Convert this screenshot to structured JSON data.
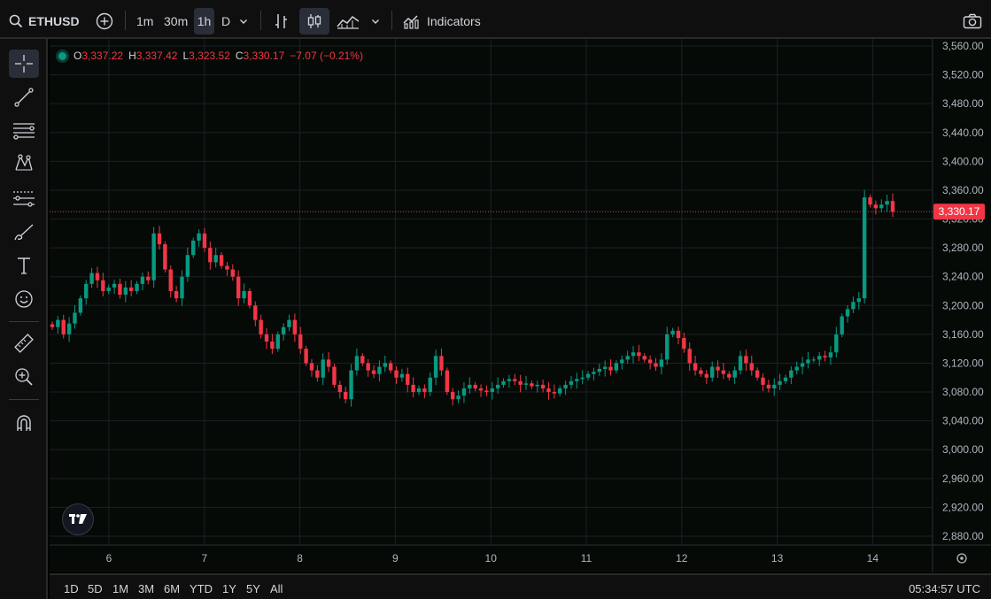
{
  "topbar": {
    "symbol": "ETHUSD",
    "intervals": [
      "1m",
      "30m",
      "1h",
      "D"
    ],
    "active_interval": "1h",
    "indicators_label": "Indicators"
  },
  "legend": {
    "o_label": "O",
    "o": "3,337.22",
    "h_label": "H",
    "h": "3,337.42",
    "l_label": "L",
    "l": "3,323.52",
    "c_label": "C",
    "c": "3,330.17",
    "change": "−7.07 (−0.21%)"
  },
  "bottombar": {
    "ranges": [
      "1D",
      "5D",
      "1M",
      "3M",
      "6M",
      "YTD",
      "1Y",
      "5Y",
      "All"
    ],
    "clock": "05:34:57 UTC"
  },
  "colors": {
    "up": "#089981",
    "down": "#f23645",
    "background": "#000000",
    "grid": "#1c1f26"
  },
  "chart_data": {
    "type": "candlestick",
    "interval": "1h",
    "price_labels": [
      "3,560.00",
      "3,520.00",
      "3,480.00",
      "3,440.00",
      "3,400.00",
      "3,360.00",
      "3,320.00",
      "3,280.00",
      "3,240.00",
      "3,200.00",
      "3,160.00",
      "3,120.00",
      "3,080.00",
      "3,040.00",
      "3,000.00",
      "2,960.00",
      "2,920.00",
      "2,880.00"
    ],
    "ylim": [
      2860,
      3575
    ],
    "date_labels": [
      "6",
      "7",
      "8",
      "9",
      "10",
      "11",
      "12",
      "13",
      "14"
    ],
    "current_price": 3330.17,
    "current_price_label": "3,330.17",
    "close_series": [
      3170,
      3180,
      3160,
      3175,
      3190,
      3210,
      3230,
      3245,
      3235,
      3220,
      3225,
      3230,
      3215,
      3225,
      3220,
      3230,
      3240,
      3235,
      3300,
      3285,
      3250,
      3220,
      3210,
      3240,
      3270,
      3290,
      3300,
      3280,
      3260,
      3270,
      3255,
      3250,
      3240,
      3210,
      3220,
      3200,
      3180,
      3160,
      3150,
      3140,
      3160,
      3170,
      3180,
      3160,
      3140,
      3120,
      3110,
      3100,
      3125,
      3115,
      3090,
      3080,
      3070,
      3110,
      3130,
      3120,
      3110,
      3105,
      3115,
      3120,
      3110,
      3100,
      3105,
      3090,
      3080,
      3085,
      3080,
      3100,
      3130,
      3110,
      3080,
      3070,
      3075,
      3085,
      3090,
      3085,
      3082,
      3080,
      3085,
      3090,
      3095,
      3098,
      3095,
      3090,
      3092,
      3088,
      3090,
      3085,
      3080,
      3078,
      3085,
      3090,
      3095,
      3098,
      3100,
      3105,
      3108,
      3112,
      3115,
      3110,
      3120,
      3125,
      3130,
      3135,
      3130,
      3125,
      3120,
      3115,
      3125,
      3160,
      3165,
      3155,
      3140,
      3120,
      3110,
      3105,
      3100,
      3115,
      3110,
      3105,
      3100,
      3110,
      3130,
      3120,
      3110,
      3100,
      3090,
      3085,
      3090,
      3095,
      3100,
      3110,
      3115,
      3120,
      3125,
      3125,
      3130,
      3128,
      3135,
      3160,
      3185,
      3195,
      3205,
      3210,
      3350,
      3340,
      3335,
      3340,
      3345,
      3330
    ]
  }
}
